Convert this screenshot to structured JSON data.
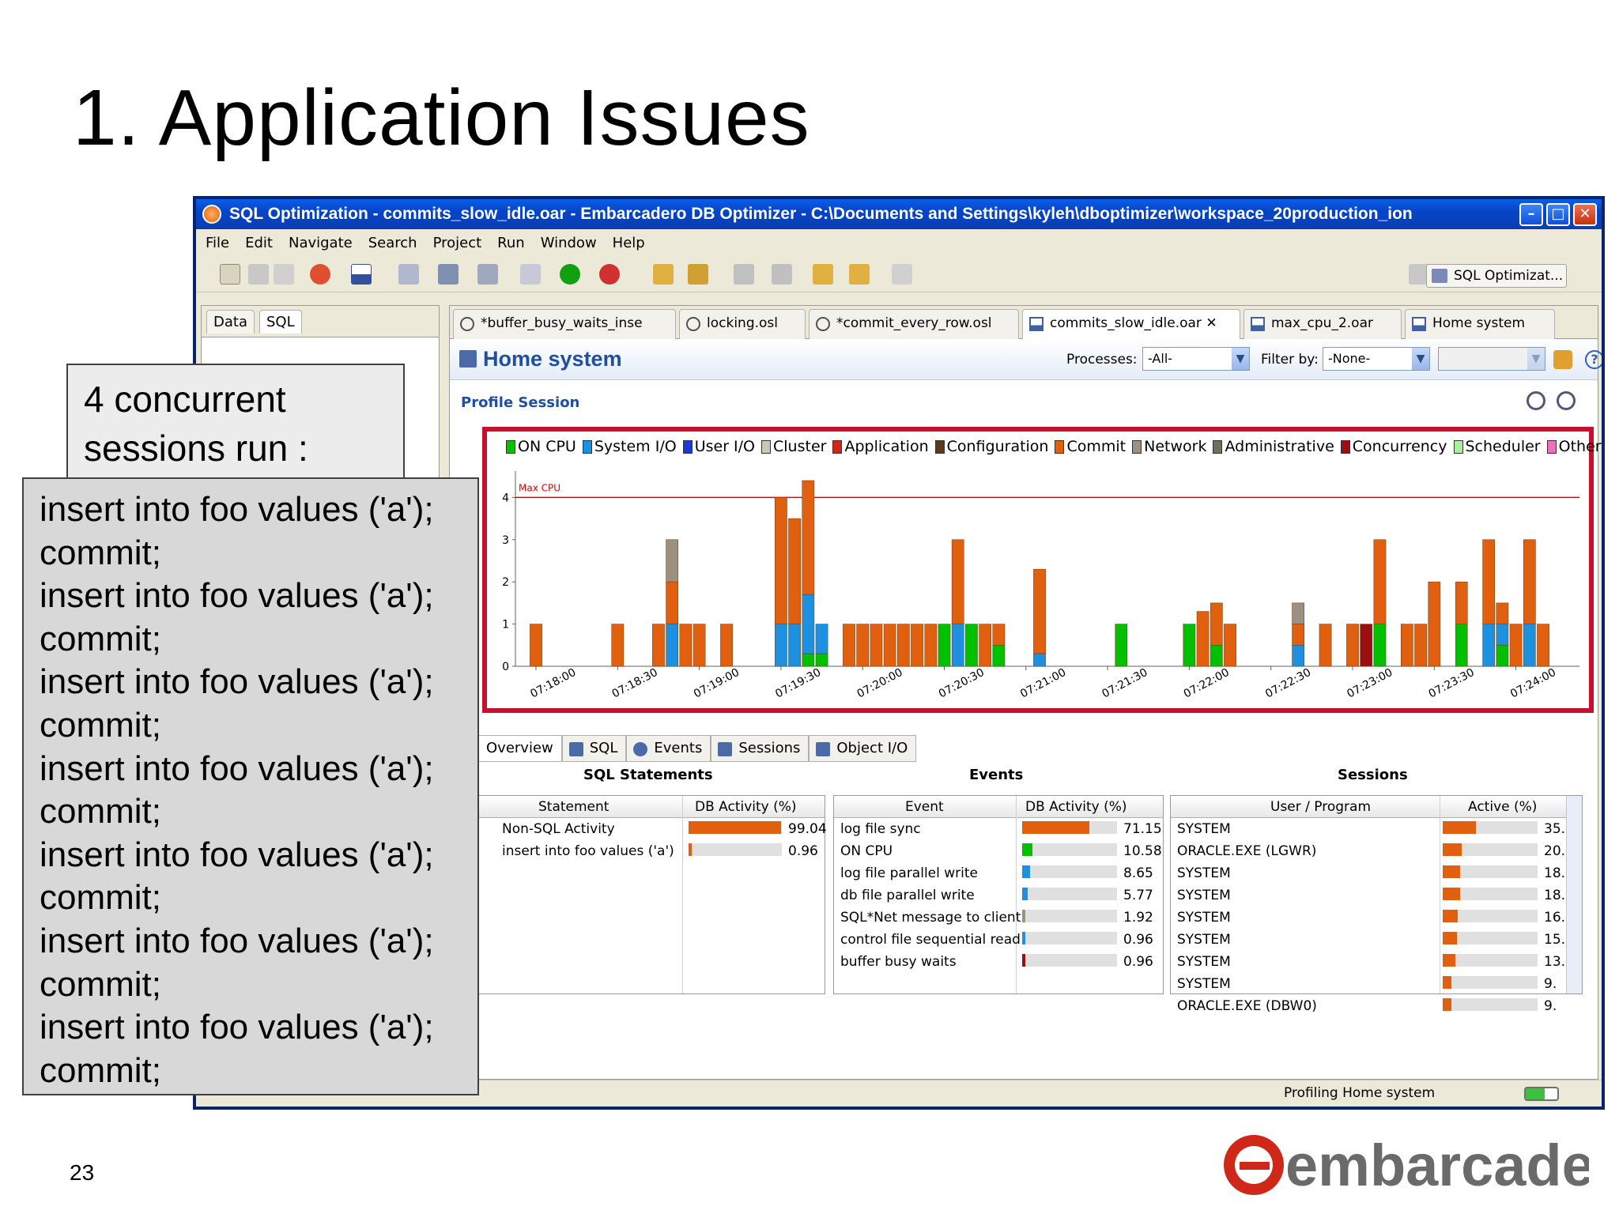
{
  "slide": {
    "title": "1. Application Issues",
    "page_number": "23",
    "logo_text": "embarcadero"
  },
  "window": {
    "title": "SQL Optimization - commits_slow_idle.oar - Embarcadero DB Optimizer - C:\\Documents and Settings\\kyleh\\dboptimizer\\workspace_20production_ion",
    "menu": [
      "File",
      "Edit",
      "Navigate",
      "Search",
      "Project",
      "Run",
      "Window",
      "Help"
    ],
    "perspective_label": "SQL Optimizat...",
    "left_tabs": [
      "Data",
      "SQL"
    ],
    "editor_tabs": [
      "*buffer_busy_waits_inse",
      "locking.osl",
      "*commit_every_row.osl",
      "commits_slow_idle.oar",
      "max_cpu_2.oar",
      "Home system"
    ],
    "active_editor_tab": "commits_slow_idle.oar",
    "header_title": "Home system",
    "processes_label": "Processes:",
    "processes_value": "-All-",
    "filter_label": "Filter by:",
    "filter_value": "-None-",
    "profile_session_label": "Profile Session",
    "status_text": "Profiling Home system"
  },
  "chart_data": {
    "type": "bar",
    "legend": [
      {
        "name": "ON CPU",
        "color": "#00c000"
      },
      {
        "name": "System I/O",
        "color": "#1e90e0"
      },
      {
        "name": "User I/O",
        "color": "#1a3ad0"
      },
      {
        "name": "Cluster",
        "color": "#c8c8b4"
      },
      {
        "name": "Application",
        "color": "#d02818"
      },
      {
        "name": "Configuration",
        "color": "#5a3a1a"
      },
      {
        "name": "Commit",
        "color": "#e06010"
      },
      {
        "name": "Network",
        "color": "#9c9080"
      },
      {
        "name": "Administrative",
        "color": "#707060"
      },
      {
        "name": "Concurrency",
        "color": "#9a1010"
      },
      {
        "name": "Scheduler",
        "color": "#a8f0a0"
      },
      {
        "name": "Other",
        "color": "#f070c0"
      }
    ],
    "max_line": {
      "label": "Max CPU",
      "value": 4
    },
    "ylim": [
      0,
      4.4
    ],
    "yticks": [
      "0",
      "1",
      "2",
      "3",
      "4"
    ],
    "xticks": [
      "07:18:00",
      "07:18:30",
      "07:19:00",
      "07:19:30",
      "07:20:00",
      "07:20:30",
      "07:21:00",
      "07:21:30",
      "07:22:00",
      "07:22:30",
      "07:23:00",
      "07:23:30",
      "07:24:00"
    ],
    "bars": [
      {
        "slot": 2,
        "stack": [
          [
            "Commit",
            1
          ]
        ]
      },
      {
        "slot": 8,
        "stack": [
          [
            "Commit",
            1
          ]
        ]
      },
      {
        "slot": 11,
        "stack": [
          [
            "Commit",
            1
          ]
        ]
      },
      {
        "slot": 12,
        "stack": [
          [
            "System I/O",
            1
          ],
          [
            "Commit",
            1
          ],
          [
            "Network",
            1
          ]
        ]
      },
      {
        "slot": 13,
        "stack": [
          [
            "Commit",
            1
          ]
        ]
      },
      {
        "slot": 14,
        "stack": [
          [
            "Commit",
            1
          ]
        ]
      },
      {
        "slot": 16,
        "stack": [
          [
            "Commit",
            1
          ]
        ]
      },
      {
        "slot": 20,
        "stack": [
          [
            "System I/O",
            1
          ],
          [
            "Commit",
            3
          ]
        ]
      },
      {
        "slot": 21,
        "stack": [
          [
            "System I/O",
            1
          ],
          [
            "Commit",
            2.5
          ]
        ]
      },
      {
        "slot": 22,
        "stack": [
          [
            "ON CPU",
            0.3
          ],
          [
            "System I/O",
            1.4
          ],
          [
            "Commit",
            2.7
          ]
        ]
      },
      {
        "slot": 23,
        "stack": [
          [
            "ON CPU",
            0.3
          ],
          [
            "System I/O",
            0.7
          ]
        ]
      },
      {
        "slot": 25,
        "stack": [
          [
            "Commit",
            1
          ]
        ]
      },
      {
        "slot": 26,
        "stack": [
          [
            "Commit",
            1
          ]
        ]
      },
      {
        "slot": 27,
        "stack": [
          [
            "Commit",
            1
          ]
        ]
      },
      {
        "slot": 28,
        "stack": [
          [
            "Commit",
            1
          ]
        ]
      },
      {
        "slot": 29,
        "stack": [
          [
            "Commit",
            1
          ]
        ]
      },
      {
        "slot": 30,
        "stack": [
          [
            "Commit",
            1
          ]
        ]
      },
      {
        "slot": 31,
        "stack": [
          [
            "Commit",
            1
          ]
        ]
      },
      {
        "slot": 32,
        "stack": [
          [
            "ON CPU",
            1
          ]
        ]
      },
      {
        "slot": 33,
        "stack": [
          [
            "System I/O",
            1
          ],
          [
            "Commit",
            2
          ]
        ]
      },
      {
        "slot": 34,
        "stack": [
          [
            "ON CPU",
            1
          ]
        ]
      },
      {
        "slot": 35,
        "stack": [
          [
            "Commit",
            1
          ]
        ]
      },
      {
        "slot": 36,
        "stack": [
          [
            "ON CPU",
            0.5
          ],
          [
            "Commit",
            0.5
          ]
        ]
      },
      {
        "slot": 39,
        "stack": [
          [
            "System I/O",
            0.3
          ],
          [
            "Commit",
            2
          ]
        ]
      },
      {
        "slot": 45,
        "stack": [
          [
            "ON CPU",
            1
          ]
        ]
      },
      {
        "slot": 50,
        "stack": [
          [
            "ON CPU",
            1
          ]
        ]
      },
      {
        "slot": 51,
        "stack": [
          [
            "Commit",
            1.3
          ]
        ]
      },
      {
        "slot": 52,
        "stack": [
          [
            "ON CPU",
            0.5
          ],
          [
            "Commit",
            1
          ]
        ]
      },
      {
        "slot": 53,
        "stack": [
          [
            "Commit",
            1
          ]
        ]
      },
      {
        "slot": 58,
        "stack": [
          [
            "System I/O",
            0.5
          ],
          [
            "Commit",
            0.5
          ],
          [
            "Network",
            0.5
          ]
        ]
      },
      {
        "slot": 60,
        "stack": [
          [
            "Commit",
            1
          ]
        ]
      },
      {
        "slot": 62,
        "stack": [
          [
            "Commit",
            1
          ]
        ]
      },
      {
        "slot": 63,
        "stack": [
          [
            "Concurrency",
            1
          ]
        ]
      },
      {
        "slot": 64,
        "stack": [
          [
            "ON CPU",
            1
          ],
          [
            "Commit",
            2
          ]
        ]
      },
      {
        "slot": 66,
        "stack": [
          [
            "Commit",
            1
          ]
        ]
      },
      {
        "slot": 67,
        "stack": [
          [
            "Commit",
            1
          ]
        ]
      },
      {
        "slot": 68,
        "stack": [
          [
            "Commit",
            2
          ]
        ]
      },
      {
        "slot": 70,
        "stack": [
          [
            "ON CPU",
            1
          ],
          [
            "Commit",
            1
          ]
        ]
      },
      {
        "slot": 72,
        "stack": [
          [
            "System I/O",
            1
          ],
          [
            "Commit",
            2
          ]
        ]
      },
      {
        "slot": 73,
        "stack": [
          [
            "ON CPU",
            0.5
          ],
          [
            "System I/O",
            0.5
          ],
          [
            "Commit",
            0.5
          ]
        ]
      },
      {
        "slot": 74,
        "stack": [
          [
            "Commit",
            1
          ]
        ]
      },
      {
        "slot": 75,
        "stack": [
          [
            "System I/O",
            1
          ],
          [
            "Commit",
            2
          ]
        ]
      },
      {
        "slot": 76,
        "stack": [
          [
            "Commit",
            1
          ]
        ]
      }
    ]
  },
  "bottom_tabs": [
    "Overview",
    "SQL",
    "Events",
    "Sessions",
    "Object I/O"
  ],
  "sql_statements": {
    "title": "SQL Statements",
    "columns": [
      "Statement",
      "DB Activity (%)"
    ],
    "rows": [
      {
        "name": "Non-SQL Activity",
        "value": "99.04",
        "pct": 99.04
      },
      {
        "name": "insert into foo values ('a')",
        "value": "0.96",
        "pct": 0.96
      }
    ]
  },
  "events": {
    "title": "Events",
    "columns": [
      "Event",
      "DB Activity (%)"
    ],
    "rows": [
      {
        "name": "log file sync",
        "value": "71.15",
        "pct": 71.15,
        "color": "#e06010"
      },
      {
        "name": "ON CPU",
        "value": "10.58",
        "pct": 10.58,
        "color": "#00c000"
      },
      {
        "name": "log file parallel write",
        "value": "8.65",
        "pct": 8.65,
        "color": "#1e90e0"
      },
      {
        "name": "db file parallel write",
        "value": "5.77",
        "pct": 5.77,
        "color": "#1e90e0"
      },
      {
        "name": "SQL*Net message to client",
        "value": "1.92",
        "pct": 1.92,
        "color": "#9c9080"
      },
      {
        "name": "control file sequential read",
        "value": "0.96",
        "pct": 0.96,
        "color": "#1e90e0"
      },
      {
        "name": "buffer busy waits",
        "value": "0.96",
        "pct": 0.96,
        "color": "#9a1010"
      }
    ]
  },
  "sessions": {
    "title": "Sessions",
    "columns": [
      "User / Program",
      "Active (%)"
    ],
    "rows": [
      {
        "name": "SYSTEM",
        "value": "35.",
        "pct": 35
      },
      {
        "name": "ORACLE.EXE (LGWR)",
        "value": "20.",
        "pct": 20
      },
      {
        "name": "SYSTEM",
        "value": "18.",
        "pct": 18
      },
      {
        "name": "SYSTEM",
        "value": "18.",
        "pct": 18
      },
      {
        "name": "SYSTEM",
        "value": "16.",
        "pct": 16
      },
      {
        "name": "SYSTEM",
        "value": "15.",
        "pct": 15
      },
      {
        "name": "SYSTEM",
        "value": "13.",
        "pct": 13
      },
      {
        "name": "SYSTEM",
        "value": "9.",
        "pct": 9
      },
      {
        "name": "ORACLE.EXE (DBW0)",
        "value": "9.",
        "pct": 9
      }
    ]
  },
  "callouts": {
    "header_line1": "4 concurrent",
    "header_line2": "sessions run :",
    "lines": [
      "insert into foo values ('a');",
      "commit;",
      "insert into foo values ('a');",
      "commit;",
      "insert into foo values ('a');",
      "commit;",
      "insert into foo values ('a');",
      "commit;",
      "insert into foo values ('a');",
      "commit;",
      "insert into foo values ('a');",
      "commit;",
      "insert into foo values ('a');",
      "commit;"
    ]
  }
}
